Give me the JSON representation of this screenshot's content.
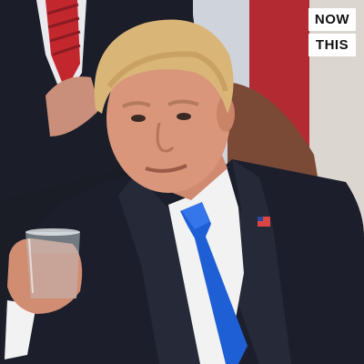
{
  "logo": {
    "line1": "NOW",
    "line2": "THIS"
  },
  "colors": {
    "suit": "#1c1f2b",
    "tie": "#1f5fd6",
    "shirt": "#f2f2f2",
    "skin": "#d9967b",
    "hair": "#d9b578",
    "flag_red": "#b42a33",
    "flag_white": "#e9e4df",
    "chair": "#7a4a36"
  }
}
